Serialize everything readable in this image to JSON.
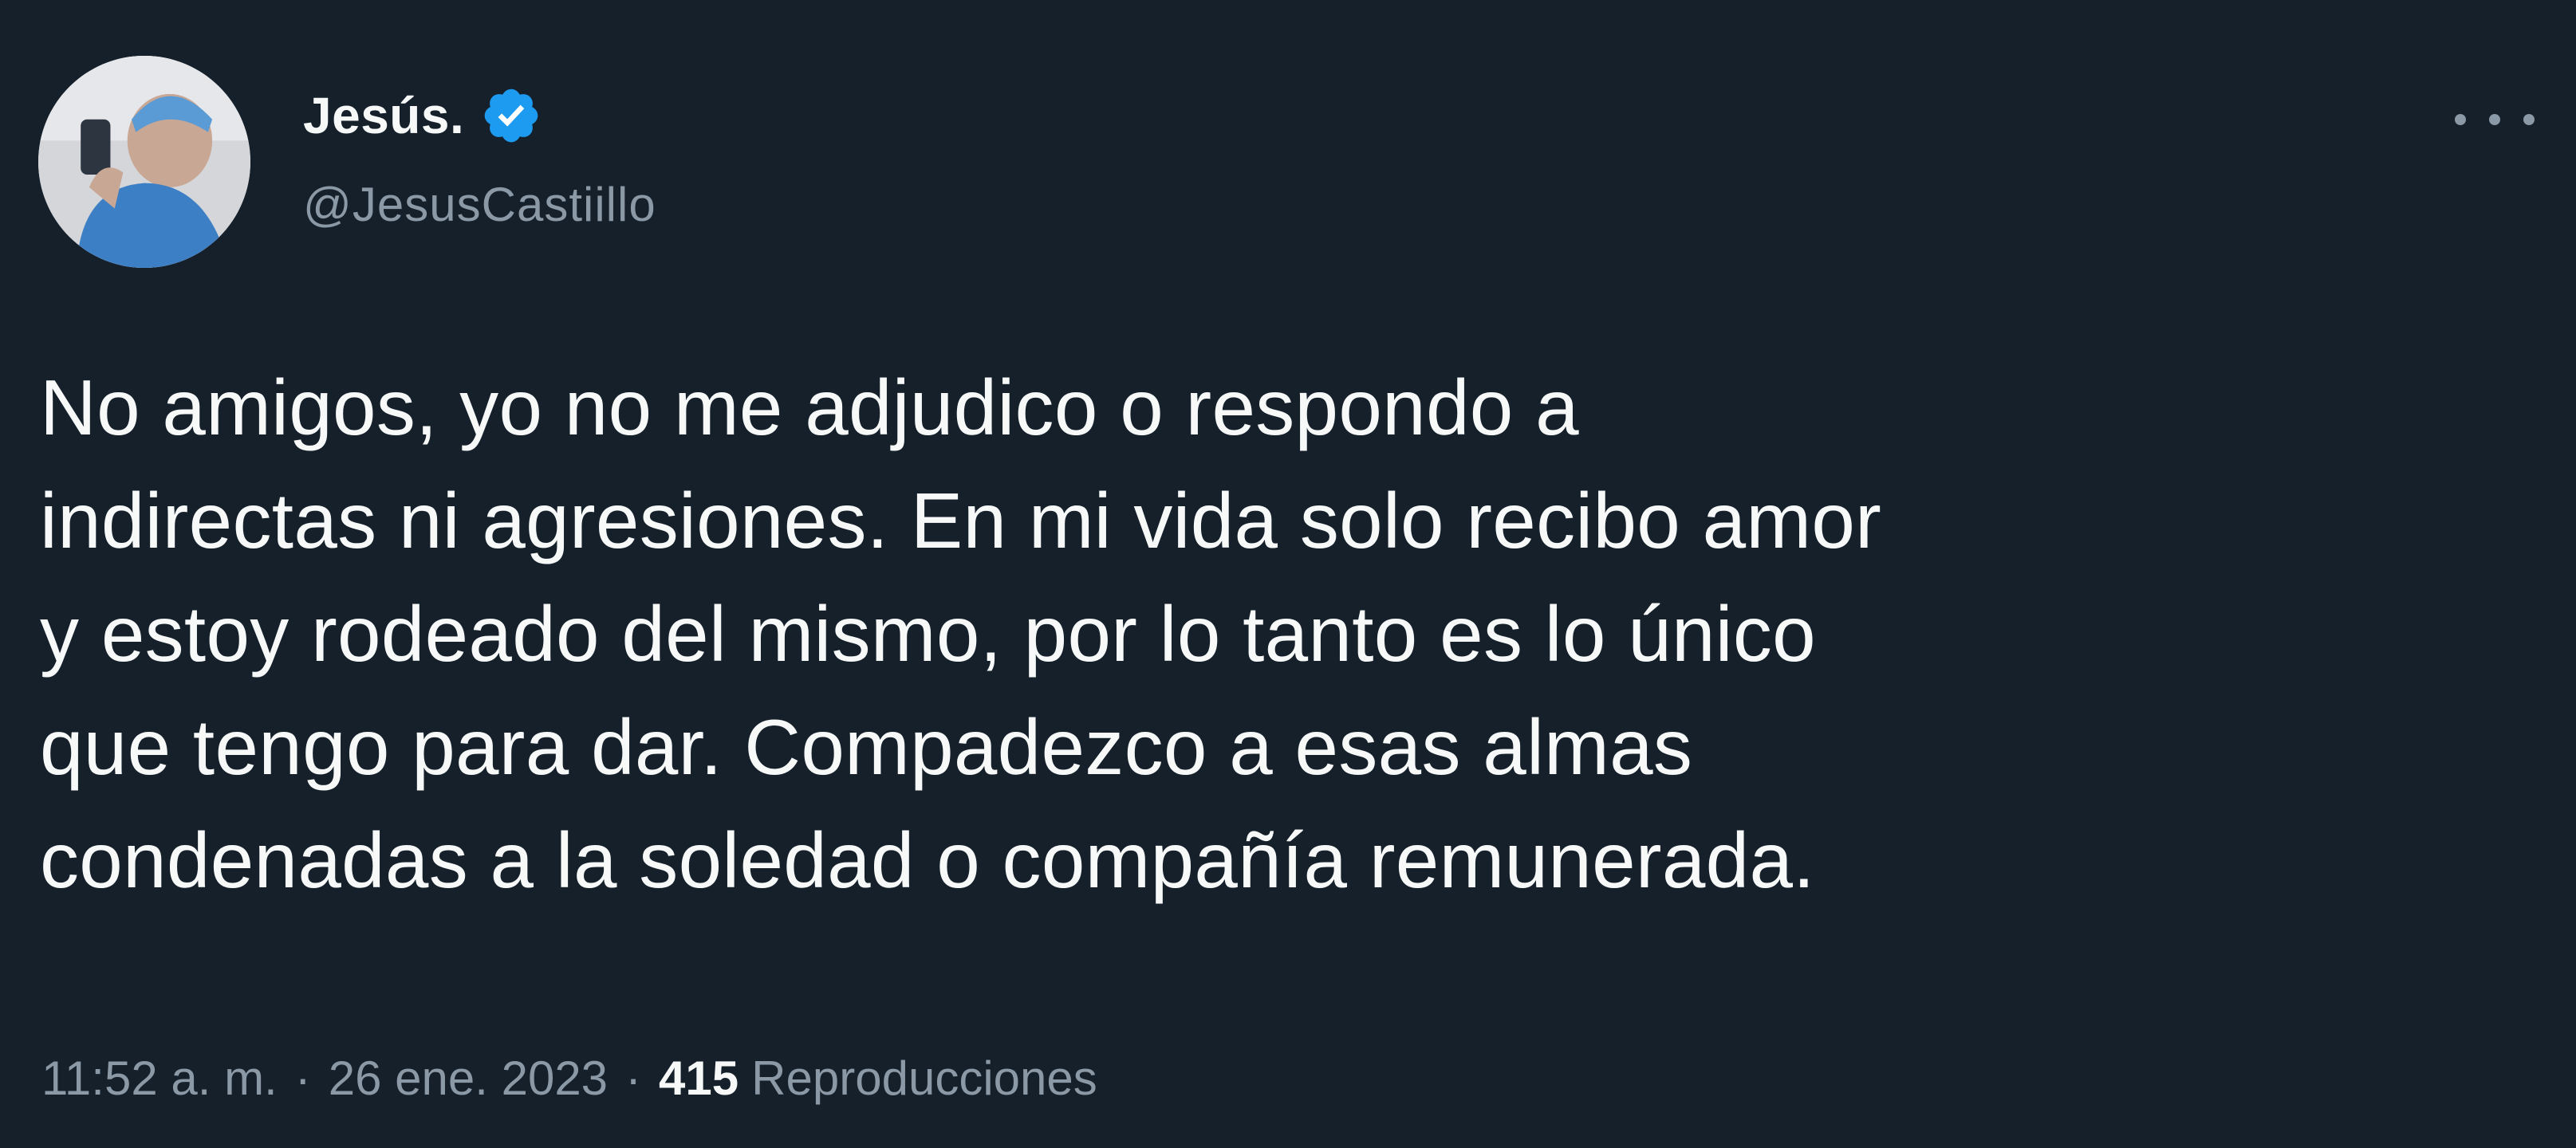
{
  "user": {
    "display_name": "Jesús.",
    "handle": "@JesusCastiillo",
    "verified": true
  },
  "tweet": {
    "lines": [
      "No amigos, yo no me adjudico o respondo a",
      "indirectas ni agresiones. En mi vida solo recibo amor",
      "y estoy rodeado del mismo, por lo tanto es lo único",
      "que tengo para dar. Compadezco a esas almas",
      "condenadas a la soledad o compañía remunerada."
    ]
  },
  "meta": {
    "time": "11:52 a. m.",
    "separator": "·",
    "date": "26 ene. 2023",
    "views_count": "415",
    "views_label": "Reproducciones"
  },
  "colors": {
    "background": "#15202b",
    "text_primary": "#f7f9f9",
    "text_secondary": "#8b98a5",
    "verified_badge": "#1d9bf0"
  },
  "icons": {
    "verified": "verified-badge-icon",
    "more": "more-options-icon"
  }
}
